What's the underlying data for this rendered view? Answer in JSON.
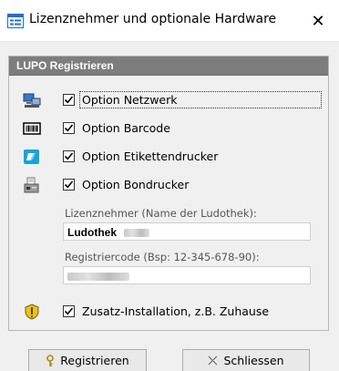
{
  "window": {
    "title": "Lizenznehmer und optionale Hardware",
    "title_icon": "form-icon",
    "close_glyph": "✕"
  },
  "group": {
    "header": "LUPO Registrieren"
  },
  "options": [
    {
      "label": "Option Netzwerk",
      "checked": true,
      "icon": "network-computer-icon"
    },
    {
      "label": "Option Barcode",
      "checked": true,
      "icon": "barcode-icon"
    },
    {
      "label": "Option Etikettendrucker",
      "checked": true,
      "icon": "label-printer-icon"
    },
    {
      "label": "Option Bondrucker",
      "checked": true,
      "icon": "receipt-printer-icon"
    }
  ],
  "licensee": {
    "label": "Lizenznehmer (Name der Ludothek):",
    "value": "Ludothek"
  },
  "regcode": {
    "label": "Registriercode (Bsp: 12-345-678-90):",
    "value": ""
  },
  "extra_install": {
    "label": "Zusatz-Installation, z.B. Zuhause",
    "checked": true,
    "icon": "shield-icon"
  },
  "buttons": {
    "register": "Registrieren",
    "register_icon": "key-icon",
    "close": "Schliessen",
    "close_icon": "close-icon"
  },
  "colors": {
    "group_header_bg": "#7d7d7d",
    "window_bg": "#f0f0f0",
    "title_icon_accent": "#1e6fd9"
  }
}
